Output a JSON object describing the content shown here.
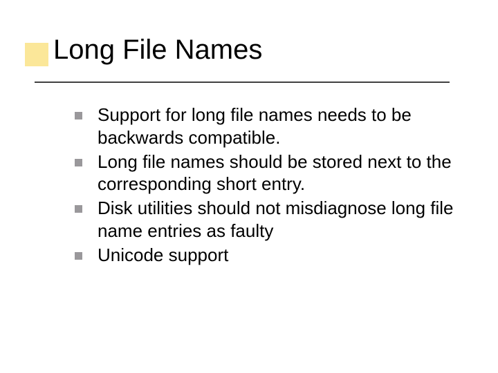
{
  "title": "Long File Names",
  "bullets": [
    {
      "text": "Support for long file names needs to be backwards compatible."
    },
    {
      "text": "Long file names should be stored next to the corresponding short entry."
    },
    {
      "text": "Disk utilities should not misdiagnose long file name entries as faulty"
    },
    {
      "text": "Unicode support"
    }
  ]
}
